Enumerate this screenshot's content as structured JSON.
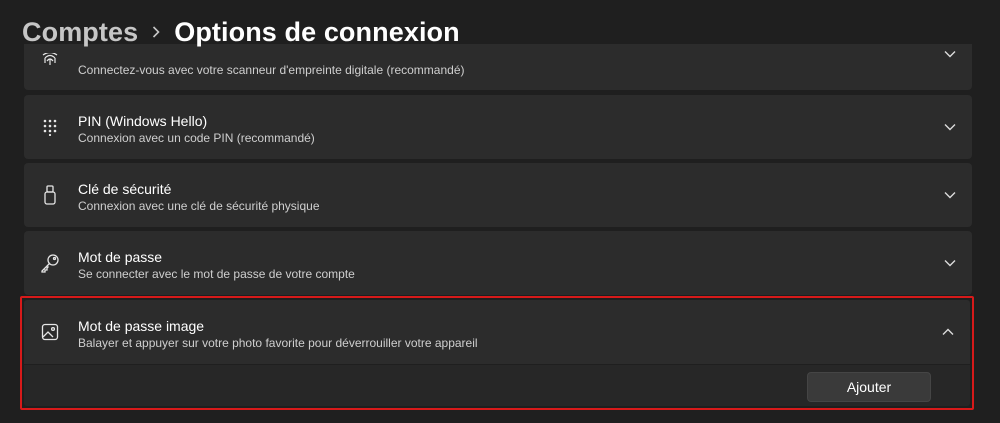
{
  "breadcrumb": {
    "parent": "Comptes",
    "current": "Options de connexion"
  },
  "colors": {
    "background": "#1f1f1f",
    "card": "#2c2c2c",
    "highlight_border": "#d71a1a"
  },
  "options": [
    {
      "icon": "fingerprint-icon",
      "title": "",
      "description": "Connectez-vous avec votre scanneur d'empreinte digitale (recommandé)"
    },
    {
      "icon": "pin-keypad-icon",
      "title": "PIN (Windows Hello)",
      "description": "Connexion avec un code PIN (recommandé)"
    },
    {
      "icon": "security-key-icon",
      "title": "Clé de sécurité",
      "description": "Connexion avec une clé de sécurité physique"
    },
    {
      "icon": "key-icon",
      "title": "Mot de passe",
      "description": "Se connecter avec le mot de passe de votre compte"
    },
    {
      "icon": "picture-icon",
      "title": "Mot de passe image",
      "description": "Balayer et appuyer sur votre photo favorite pour déverrouiller votre appareil",
      "expanded": true,
      "action_label": "Ajouter"
    }
  ]
}
